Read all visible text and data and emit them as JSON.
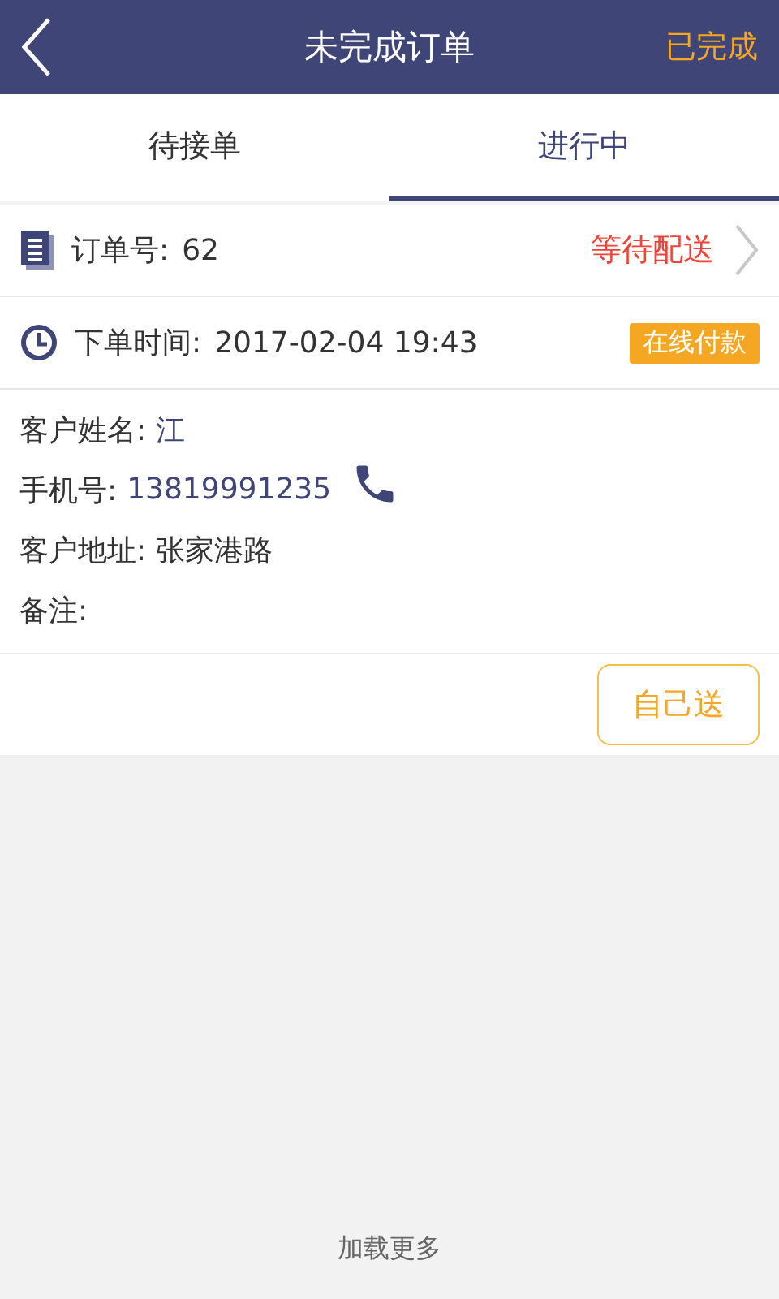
{
  "header": {
    "title": "未完成订单",
    "action": "已完成"
  },
  "tabs": [
    {
      "label": "待接单",
      "selected": false
    },
    {
      "label": "进行中",
      "selected": true
    }
  ],
  "order": {
    "number_label": "订单号:",
    "number": "62",
    "status": "等待配送",
    "time_label": "下单时间:",
    "time": "2017-02-04 19:43",
    "payment": "在线付款",
    "fields": [
      {
        "kind": "text",
        "label": "客户姓名:",
        "value": "江",
        "highlight": true
      },
      {
        "kind": "phone",
        "label": "手机号:",
        "value": "13819991235",
        "highlight": true
      },
      {
        "kind": "text",
        "label": "客户地址:",
        "value": "张家港路",
        "highlight": false
      },
      {
        "kind": "text",
        "label": "备注:"
      }
    ],
    "button": "自己送"
  },
  "load_more": "加载更多"
}
